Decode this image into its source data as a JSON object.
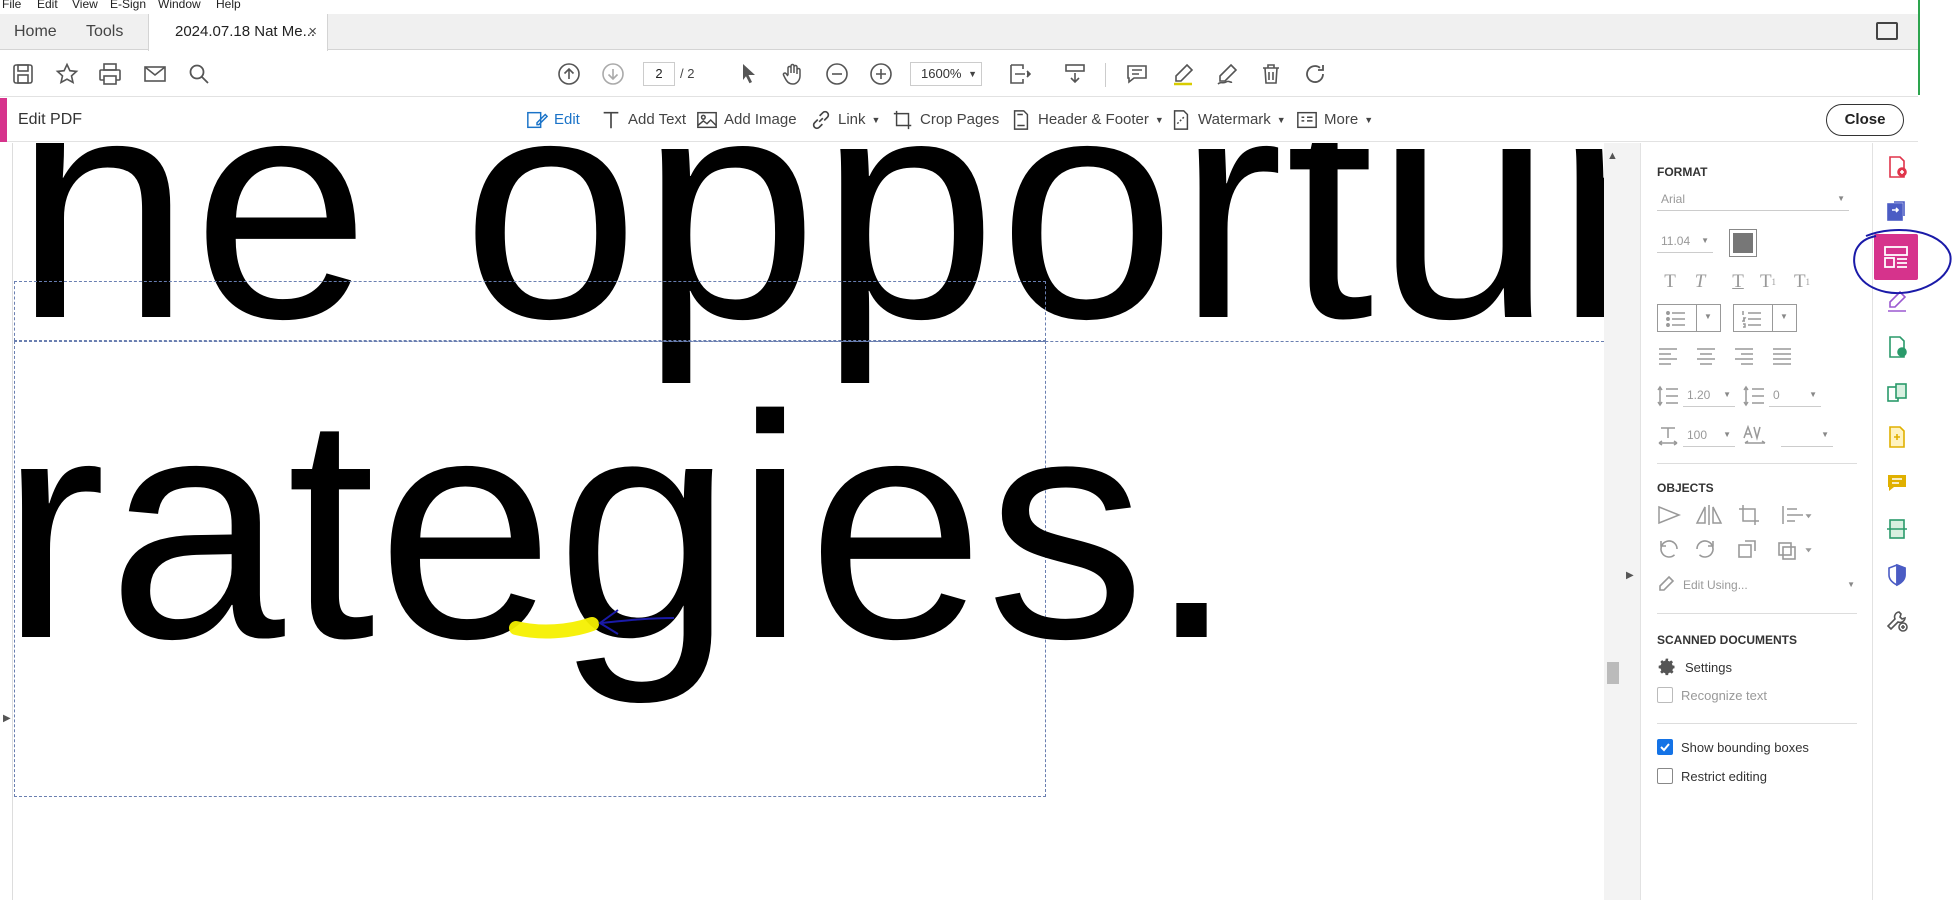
{
  "menu": [
    "File",
    "Edit",
    "View",
    "E-Sign",
    "Window",
    "Help"
  ],
  "tabs": {
    "home": "Home",
    "tools": "Tools",
    "document": "2024.07.18 Nat Me...",
    "close_glyph": "×"
  },
  "toolbar": {
    "page_current": "2",
    "page_total": "/ 2",
    "zoom": "1600%"
  },
  "edit_bar": {
    "title": "Edit PDF",
    "items": [
      "Edit",
      "Add Text",
      "Add Image",
      "Link",
      "Crop Pages",
      "Header & Footer",
      "Watermark",
      "More"
    ],
    "close_label": "Close"
  },
  "document": {
    "line1": "he opportunit",
    "line2": "rategies."
  },
  "panel": {
    "format_header": "FORMAT",
    "font": "Arial",
    "font_size": "11.04",
    "line_spacing": "1.20",
    "para_spacing": "0",
    "scale": "100",
    "objects_header": "OBJECTS",
    "edit_using": "Edit Using...",
    "scanned_header": "SCANNED DOCUMENTS",
    "settings_label": "Settings",
    "recognize_label": "Recognize text",
    "show_bbox_label": "Show bounding boxes",
    "show_bbox_checked": true,
    "restrict_label": "Restrict editing",
    "restrict_checked": false
  },
  "colors": {
    "accent_pink": "#d6338c",
    "accent_blue": "#1a73c8",
    "annotation_yellow": "#f5f000",
    "annotation_ink": "#1a1aa8"
  }
}
